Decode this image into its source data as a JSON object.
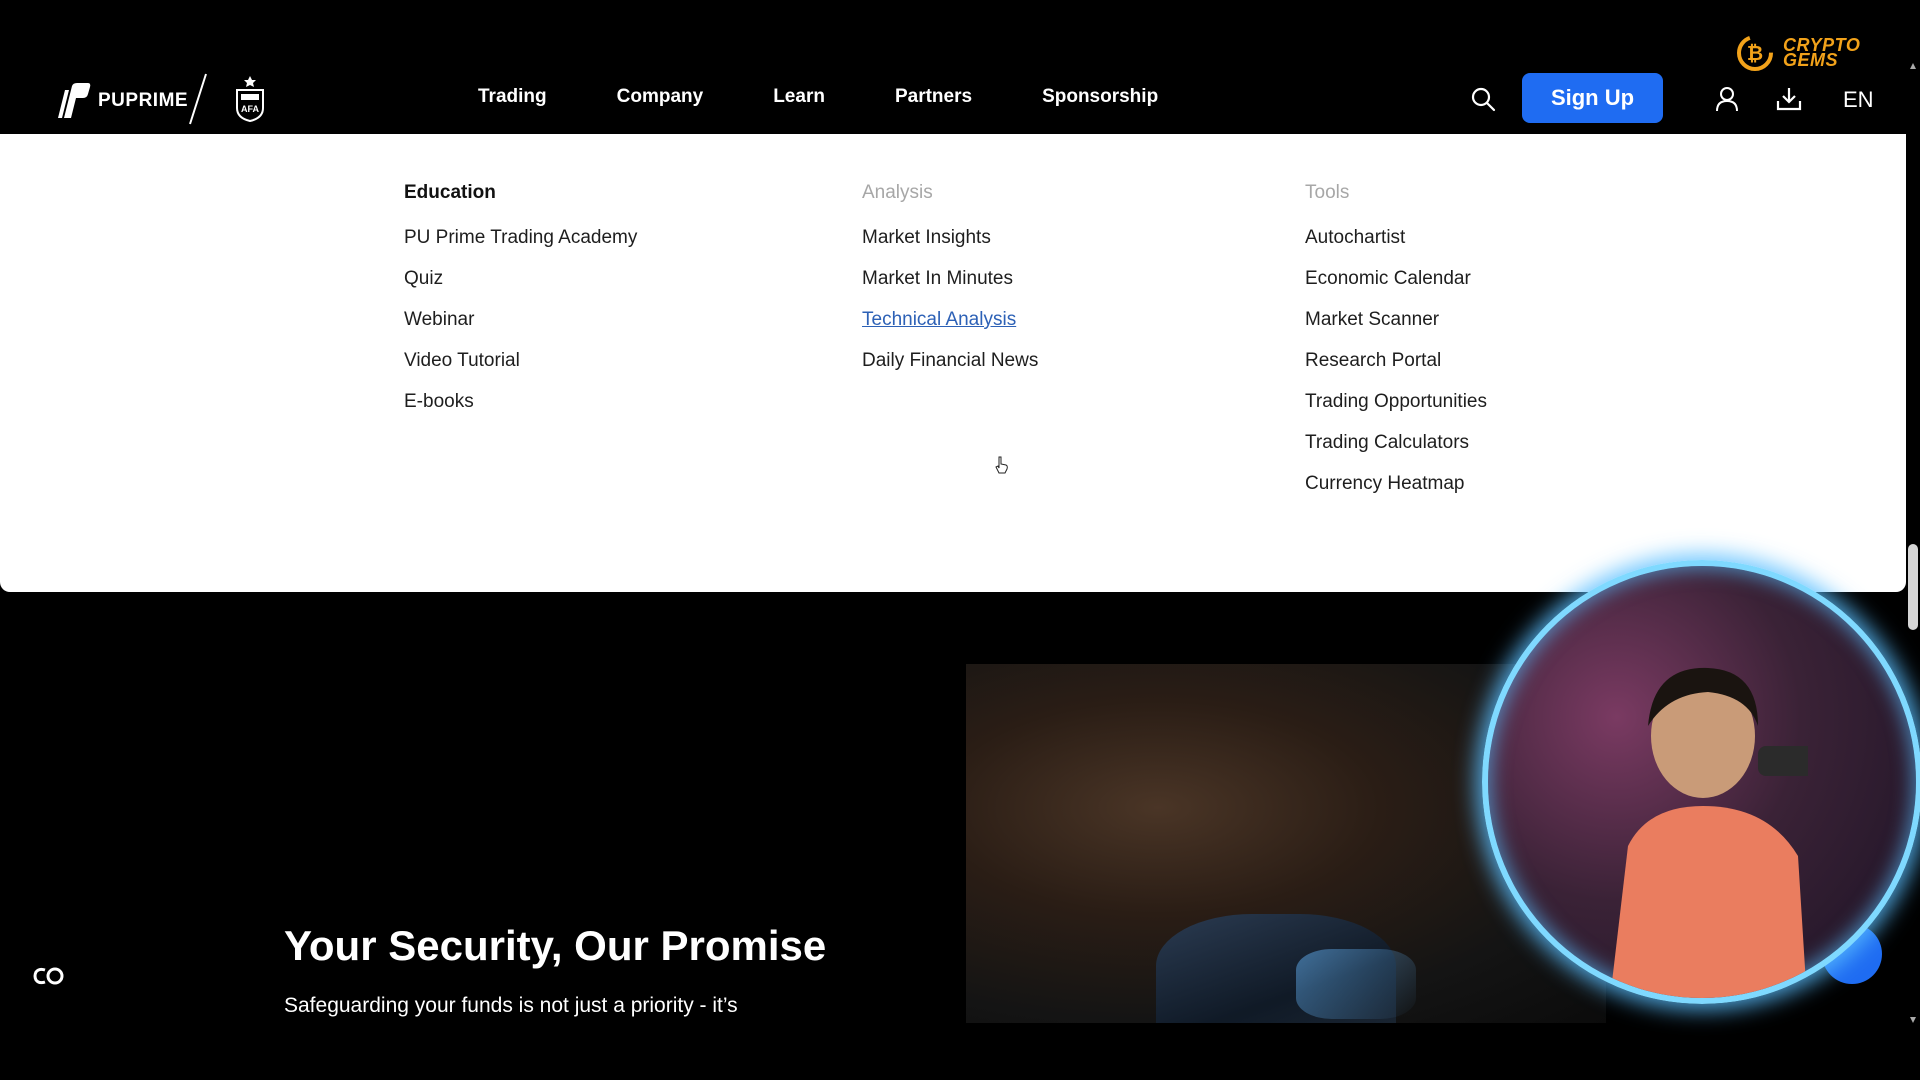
{
  "header": {
    "brand": "PUPRIME",
    "nav": [
      "Trading",
      "Company",
      "Learn",
      "Partners",
      "Sponsorship"
    ],
    "signup_label": "Sign Up",
    "language": "EN"
  },
  "overlay": {
    "channel_logo_line1": "CRYPTO",
    "channel_logo_line2": "GEMS"
  },
  "dropdown": {
    "education": {
      "title": "Education",
      "items": [
        "PU Prime Trading Academy",
        "Quiz",
        "Webinar",
        "Video Tutorial",
        "E-books"
      ]
    },
    "analysis": {
      "title": "Analysis",
      "items": [
        "Market Insights",
        "Market In Minutes",
        "Technical Analysis",
        "Daily Financial News"
      ]
    },
    "tools": {
      "title": "Tools",
      "items": [
        "Autochartist",
        "Economic Calendar",
        "Market Scanner",
        "Research Portal",
        "Trading Opportunities",
        "Trading Calculators",
        "Currency Heatmap"
      ]
    }
  },
  "hero": {
    "title": "Your Security, Our Promise",
    "subtitle": "Safeguarding your funds is not just a priority - it’s"
  },
  "colors": {
    "accent": "#1f6cf2",
    "link_hover": "#2d61b6",
    "channel_logo": "#f2a21a"
  }
}
